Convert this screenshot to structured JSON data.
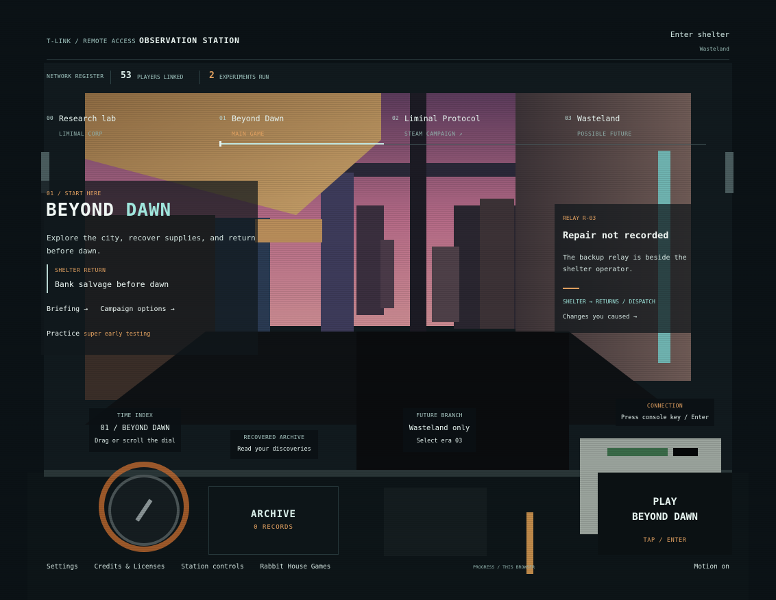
{
  "header": {
    "crumb": "T-LINK / REMOTE ACCESS",
    "station": "OBSERVATION STATION",
    "enter_shelter": "Enter shelter",
    "enter_sub": "Wasteland"
  },
  "register": {
    "label": "NETWORK REGISTER",
    "players_count": "53",
    "players_label": "PLAYERS LINKED",
    "experiments_count": "2",
    "experiments_label": "EXPERIMENTS RUN"
  },
  "eras": [
    {
      "index": "00",
      "name": "Research lab",
      "sub": "LIMINAL CORP"
    },
    {
      "index": "01",
      "name": "Beyond Dawn",
      "sub": "MAIN GAME"
    },
    {
      "index": "02",
      "name": "Liminal Protocol",
      "sub": "STEAM CAMPAIGN ↗"
    },
    {
      "index": "03",
      "name": "Wasteland",
      "sub": "POSSIBLE FUTURE"
    }
  ],
  "hero": {
    "kicker": "01 / START HERE",
    "title_a": "BEYOND ",
    "title_b": "DAWN",
    "description": "Explore the city, recover supplies, and return before dawn.",
    "shelter_label": "SHELTER RETURN",
    "shelter_value": "Bank salvage before dawn",
    "link_briefing": "Briefing →",
    "link_campaign": "Campaign options →",
    "practice": "Practice",
    "practice_tag": "super early testing"
  },
  "relay": {
    "kicker": "RELAY R-03",
    "headline": "Repair not recorded",
    "body": "The backup relay is beside the shelter operator.",
    "route": "SHELTER → RETURNS / DISPATCH",
    "changes": "Changes you caused →"
  },
  "console": {
    "time_index": {
      "title": "TIME INDEX",
      "value": "01 / BEYOND DAWN",
      "sub": "Drag or scroll the dial"
    },
    "recovered": {
      "title": "RECOVERED ARCHIVE",
      "sub": "Read your discoveries"
    },
    "future": {
      "title": "FUTURE BRANCH",
      "value": "Wasteland only",
      "sub": "Select era 03"
    },
    "connection": {
      "title": "CONNECTION",
      "sub": "Press console key / Enter"
    }
  },
  "archive": {
    "label": "ARCHIVE",
    "count": "0 RECORDS"
  },
  "play": {
    "line1": "PLAY",
    "line2": "BEYOND DAWN",
    "hint": "TAP / ENTER"
  },
  "footer": {
    "settings": "Settings",
    "credits": "Credits & Licenses",
    "station_controls": "Station controls",
    "studio": "Rabbit House Games",
    "progress": "PROGRESS / THIS BROWSER",
    "motion": "Motion on"
  },
  "colors": {
    "accent": "#e0a060",
    "cyan": "#9fe6dd",
    "sky": "#b66a8a",
    "bg": "#0b1216"
  }
}
